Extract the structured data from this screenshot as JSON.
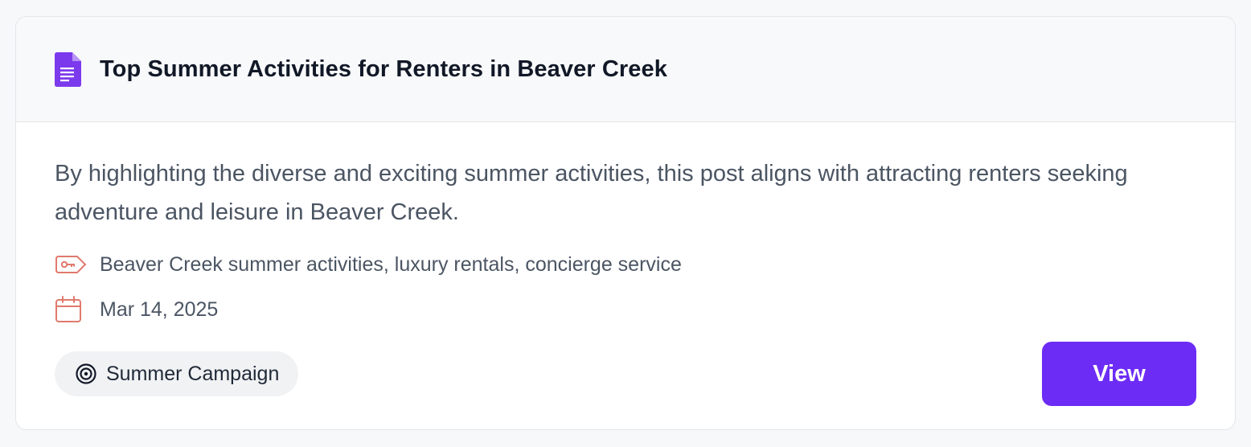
{
  "card": {
    "title": "Top Summer Activities for Renters in Beaver Creek",
    "icon": "document-icon",
    "description": "By highlighting the diverse and exciting summer activities, this post aligns with attracting renters seeking adventure and leisure in Beaver Creek.",
    "keywords": {
      "icon": "tag-key-icon",
      "text": "Beaver Creek summer activities, luxury rentals, concierge service"
    },
    "date": {
      "icon": "calendar-icon",
      "text": "Mar 14, 2025"
    },
    "campaign": {
      "icon": "target-icon",
      "label": "Summer Campaign"
    },
    "view_label": "View"
  },
  "colors": {
    "accent": "#6d2cf5",
    "icon_red": "#e07a6e",
    "text_primary": "#111827",
    "text_secondary": "#4b5563",
    "pill_bg": "#f1f2f4",
    "header_bg": "#f8f9fa"
  }
}
